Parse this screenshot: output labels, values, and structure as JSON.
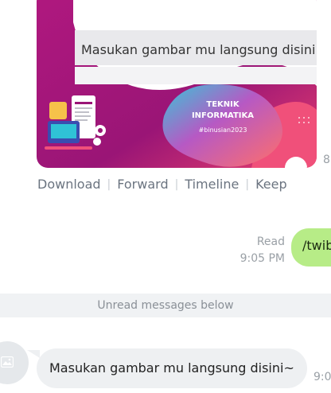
{
  "image_message": {
    "placeholder_text": "Masukan gambar mu langsung disini~",
    "poster_title_line1": "TEKNIK",
    "poster_title_line2": "INFORMATIKA",
    "poster_hashtag": "#binusian2023",
    "time_partial": "8"
  },
  "message_actions": {
    "download": "Download",
    "forward": "Forward",
    "timeline": "Timeline",
    "keep": "Keep"
  },
  "sent_message": {
    "status": "Read",
    "time": "9:05 PM",
    "text": "/twib"
  },
  "unread_divider": "Unread messages below",
  "received_message": {
    "text": "Masukan gambar mu langsung disini~",
    "time_partial": "9:0"
  },
  "colors": {
    "sent_bubble": "#b7ec87",
    "received_bubble": "#eef0f2",
    "poster_magenta": "#a0157a",
    "poster_pink": "#f0507a"
  }
}
